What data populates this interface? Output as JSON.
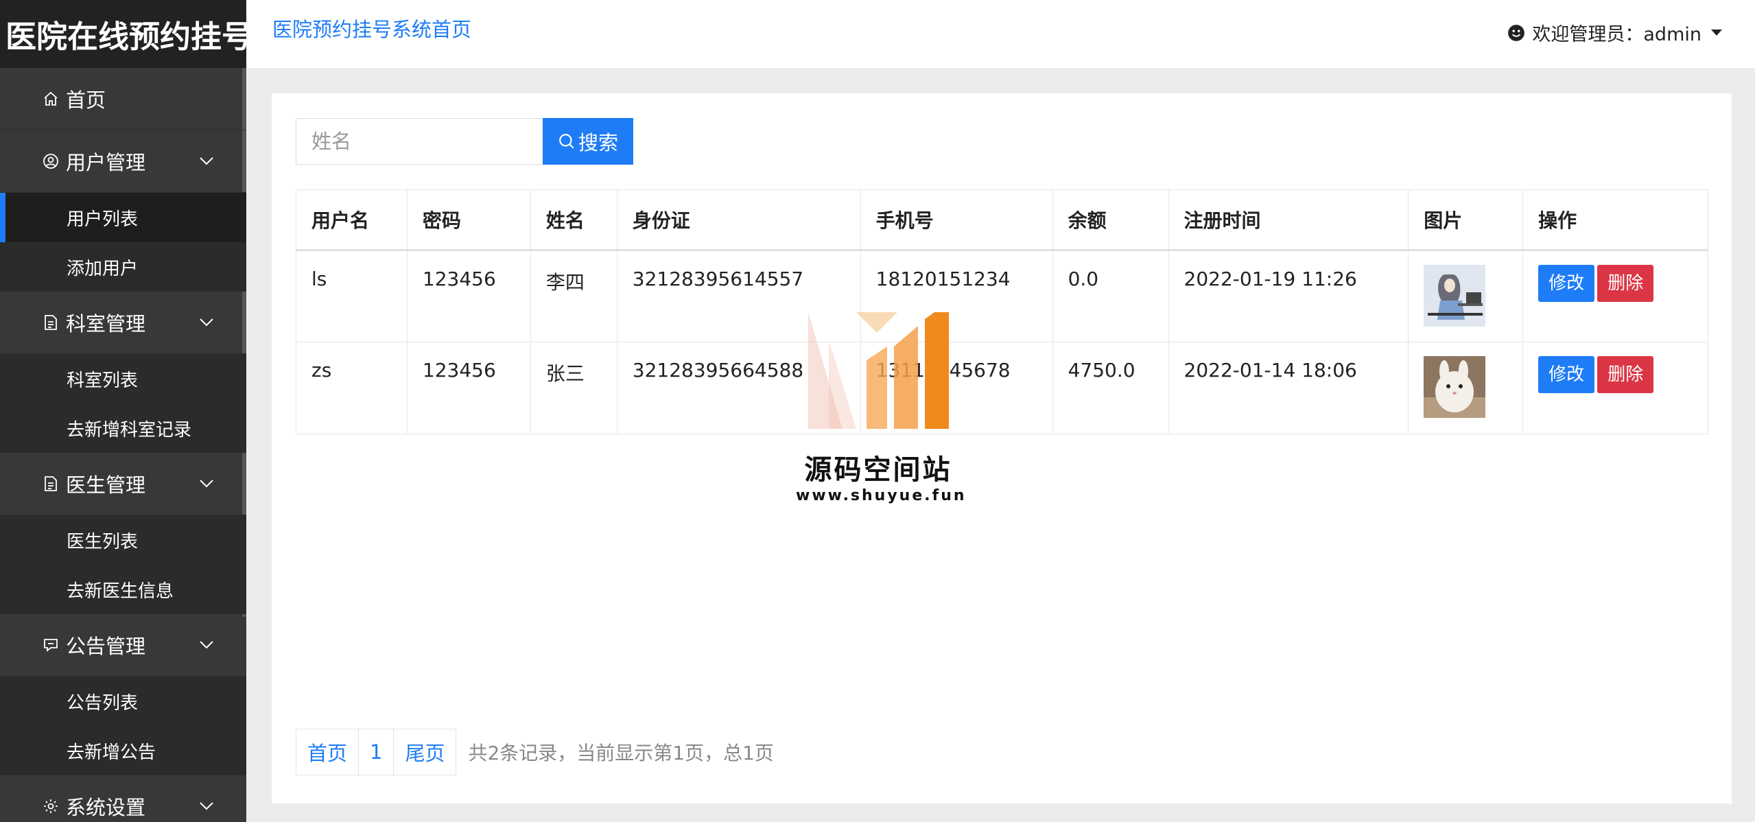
{
  "brand": "医院在线预约挂号",
  "sidebar": {
    "home": "首页",
    "groups": [
      {
        "label": "用户管理",
        "items": [
          "用户列表",
          "添加用户"
        ]
      },
      {
        "label": "科室管理",
        "items": [
          "科室列表",
          "去新增科室记录"
        ]
      },
      {
        "label": "医生管理",
        "items": [
          "医生列表",
          "去新医生信息"
        ]
      },
      {
        "label": "公告管理",
        "items": [
          "公告列表",
          "去新增公告"
        ]
      },
      {
        "label": "系统设置",
        "items": []
      }
    ],
    "active_item": "用户列表"
  },
  "header": {
    "title": "医院预约挂号系统首页",
    "user": "欢迎管理员：admin"
  },
  "search": {
    "placeholder": "姓名",
    "button": "搜索"
  },
  "table": {
    "columns": [
      "用户名",
      "密码",
      "姓名",
      "身份证",
      "手机号",
      "余额",
      "注册时间",
      "图片",
      "操作"
    ],
    "rows": [
      {
        "username": "ls",
        "password": "123456",
        "name": "李四",
        "id_card": "32128395614557",
        "phone": "18120151234",
        "balance": "0.0",
        "registered": "2022-01-19 11:26",
        "image": "woman-at-computer"
      },
      {
        "username": "zs",
        "password": "123456",
        "name": "张三",
        "id_card": "32128395664588",
        "phone": "13112345678",
        "balance": "4750.0",
        "registered": "2022-01-14 18:06",
        "image": "white-rabbit"
      }
    ],
    "actions": {
      "edit": "修改",
      "delete": "删除"
    }
  },
  "pagination": {
    "first": "首页",
    "page": "1",
    "last": "尾页",
    "info": "共2条记录，当前显示第1页，总1页"
  },
  "watermark": {
    "title": "源码空间站",
    "url": "www.shuyue.fun"
  },
  "colors": {
    "primary": "#1e7cf6",
    "danger": "#dc3545",
    "sidebar": "#383838",
    "sidebar_sub": "#2b2b2b"
  }
}
